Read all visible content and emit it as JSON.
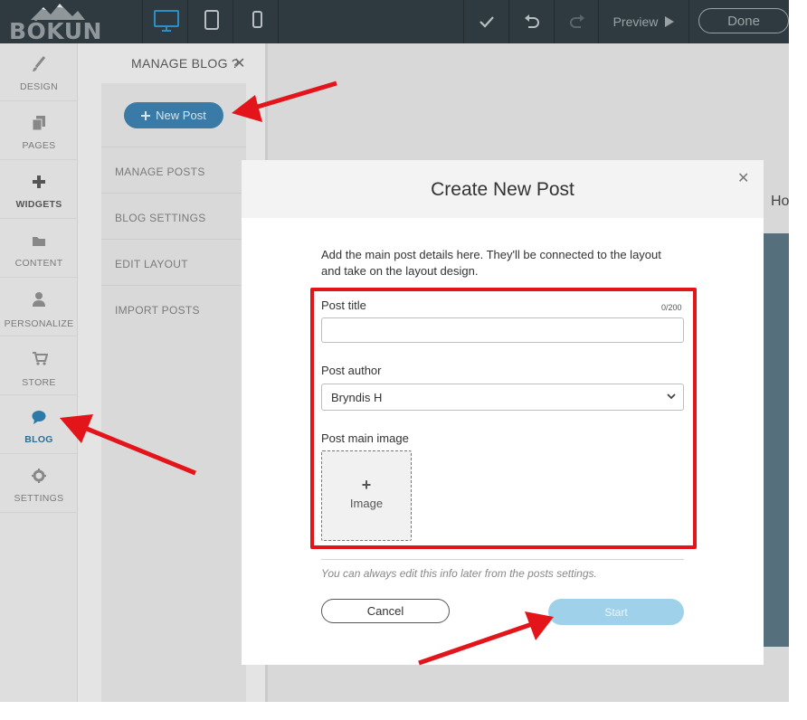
{
  "brand": {
    "logo_text": "BÓKUN"
  },
  "topbar": {
    "devices": [
      "desktop-icon",
      "tablet-icon",
      "mobile-icon"
    ],
    "preview_label": "Preview",
    "done_label": "Done"
  },
  "sidebar": {
    "items": [
      {
        "label": "DESIGN",
        "icon": "brush-icon"
      },
      {
        "label": "PAGES",
        "icon": "pages-icon"
      },
      {
        "label": "WIDGETS",
        "icon": "plus-icon"
      },
      {
        "label": "CONTENT",
        "icon": "folder-icon"
      },
      {
        "label": "PERSONALIZE",
        "icon": "user-icon"
      },
      {
        "label": "STORE",
        "icon": "cart-icon"
      },
      {
        "label": "BLOG",
        "icon": "chat-icon"
      },
      {
        "label": "SETTINGS",
        "icon": "gear-icon"
      }
    ],
    "active": "BLOG"
  },
  "blog_panel": {
    "title": "MANAGE BLOG",
    "help": "?",
    "new_post_label": "New Post",
    "links": [
      "MANAGE POSTS",
      "BLOG SETTINGS",
      "EDIT LAYOUT",
      "IMPORT POSTS"
    ]
  },
  "canvas": {
    "partial_text": "Ho"
  },
  "modal": {
    "title": "Create New Post",
    "intro": "Add the main post details here. They'll be connected to the layout and take on the layout design.",
    "post_title_label": "Post title",
    "post_title_value": "",
    "post_title_counter": "0/200",
    "post_author_label": "Post author",
    "post_author_value": "Bryndis H",
    "post_image_label": "Post main image",
    "image_button_label": "Image",
    "hint": "You can always edit this info later from the posts settings.",
    "cancel_label": "Cancel",
    "start_label": "Start"
  },
  "colors": {
    "topbar": "#2f3a40",
    "accent_blue": "#397ba6",
    "start_button": "#9fd2ea",
    "annotation_red": "#e4141b"
  }
}
